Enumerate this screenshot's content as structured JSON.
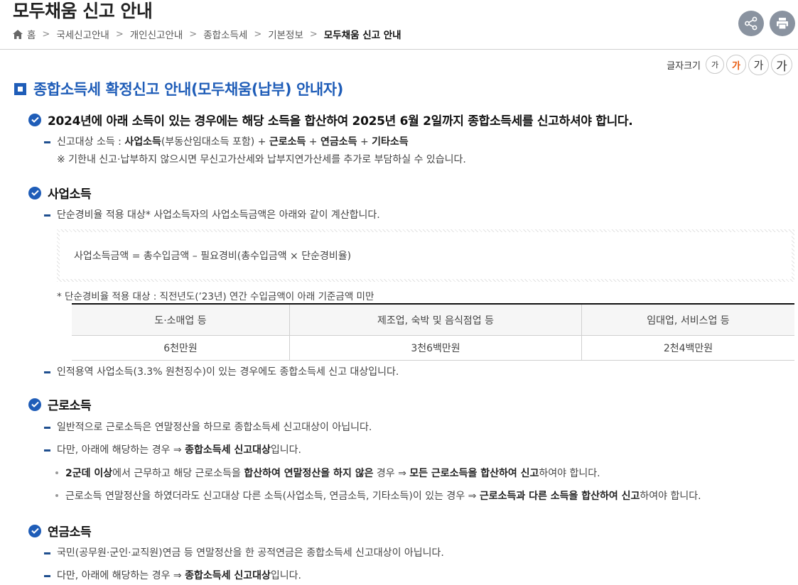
{
  "header": {
    "title": "모두채움 신고 안내",
    "breadcrumb": [
      "홈",
      "국세신고안내",
      "개인신고안내",
      "종합소득세",
      "기본정보",
      "모두채움 신고 안내"
    ]
  },
  "font_size": {
    "label": "글자크기",
    "options": [
      "가",
      "가",
      "가",
      "가"
    ],
    "active_color": "#e8590c"
  },
  "section": {
    "title": "종합소득세 확정신고 안내(모두채움(납부) 안내자)"
  },
  "intro": {
    "heading": "2024년에 아래 소득이 있는 경우에는 해당 소득을 합산하여 2025년 6월 2일까지 종합소득세를 신고하셔야 합니다.",
    "line1": {
      "prefix": "신고대상 소득 : ",
      "b1": "사업소득",
      "t1": "(부동산임대소득 포함) + ",
      "b2": "근로소득",
      "t2": " + ",
      "b3": "연금소득",
      "t3": " + ",
      "b4": "기타소득"
    },
    "line2": "※ 기한내 신고·납부하지 않으시면 무신고가산세와 납부지연가산세를 추가로 부담하실 수 있습니다."
  },
  "business": {
    "heading": "사업소득",
    "line1": "단순경비율 적용 대상* 사업소득자의 사업소득금액은 아래와 같이 계산합니다.",
    "formula": "사업소득금액 = 총수입금액 – 필요경비(총수입금액 × 단순경비율)",
    "note": "* 단순경비율 적용 대상 : 직전년도(’23년) 연간 수입금액이 아래 기준금액 미만",
    "table": {
      "headers": [
        "도·소매업 등",
        "제조업, 숙박 및 음식점업 등",
        "임대업, 서비스업 등"
      ],
      "row": [
        "6천만원",
        "3천6백만원",
        "2천4백만원"
      ]
    },
    "line2": "인적용역 사업소득(3.3% 원천징수)이 있는 경우에도 종합소득세 신고 대상입니다."
  },
  "labor": {
    "heading": "근로소득",
    "line1": "일반적으로 근로소득은 연말정산을 하므로 종합소득세 신고대상이 아닙니다.",
    "line2": {
      "t1": "다만, 아래에 해당하는 경우 ⇒ ",
      "b1": "종합소득세 신고대상",
      "t2": "입니다."
    },
    "bullet1": {
      "b1": "2군데 이상",
      "t1": "에서 근무하고 해당 근로소득을 ",
      "b2": "합산하여 연말정산을 하지 않은",
      "t2": " 경우 ⇒ ",
      "b3": "모든 근로소득을 합산하여 신고",
      "t3": "하여야 합니다."
    },
    "bullet2": {
      "t1": "근로소득 연말정산을 하였더라도 신고대상 다른 소득(사업소득, 연금소득, 기타소득)이 있는 경우 ⇒ ",
      "b1": "근로소득과 다른 소득을 합산하여 신고",
      "t2": "하여야 합니다."
    }
  },
  "pension": {
    "heading": "연금소득",
    "line1": "국민(공무원·군인·교직원)연금 등 연말정산을 한 공적연금은 종합소득세 신고대상이 아닙니다.",
    "line2": {
      "t1": "다만, 아래에 해당하는 경우 ⇒ ",
      "b1": "종합소득세 신고대상",
      "t2": "입니다."
    }
  },
  "colors": {
    "accent": "#1f5db8",
    "header_button": "#8a93a0"
  }
}
